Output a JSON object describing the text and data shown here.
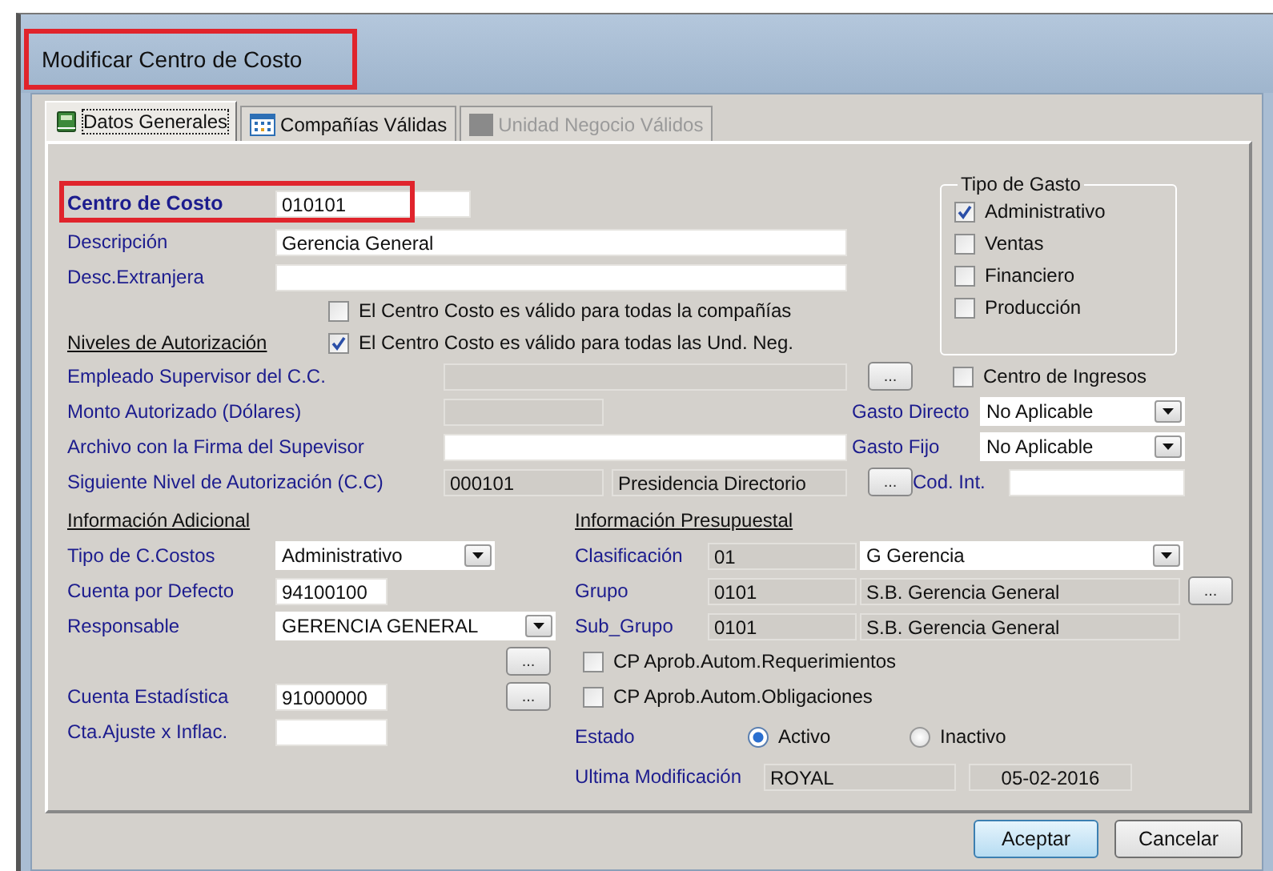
{
  "window": {
    "title": "Modificar Centro de Costo"
  },
  "tabs": [
    {
      "label": "Datos Generales",
      "selected": true,
      "disabled": false,
      "kind": "book"
    },
    {
      "label": "Compañías Válidas",
      "selected": false,
      "disabled": false,
      "kind": "grid"
    },
    {
      "label": "Unidad Negocio Válidos",
      "selected": false,
      "disabled": true,
      "kind": "blank"
    }
  ],
  "cost_center": {
    "label": "Centro de Costo",
    "value": "010101"
  },
  "description": {
    "label": "Descripción",
    "value": "Gerencia General"
  },
  "foreign_description": {
    "label": "Desc.Extranjera"
  },
  "validity": [
    {
      "label": "El Centro Costo es válido para todas la compañías",
      "checked": false
    },
    {
      "label": "El Centro Costo es válido para todas las Und. Neg.",
      "checked": true
    }
  ],
  "authorization": {
    "heading": "Niveles de Autorización",
    "rows": [
      {
        "label": "Empleado Supervisor del C.C.",
        "fields": [
          {
            "disabled": true
          }
        ],
        "lookup": "..."
      },
      {
        "label": "Monto Autorizado (Dólares)",
        "fields": [
          {
            "disabled": true
          }
        ]
      },
      {
        "label": "Archivo con la Firma del Supevisor",
        "fields": [
          {
            "disabled": false
          }
        ]
      },
      {
        "label": "Siguiente Nivel de Autorización (C.C)",
        "fields": [
          {
            "value": "000101",
            "disabled": true
          },
          {
            "value": "Presidencia Directorio",
            "disabled": true
          }
        ],
        "lookup": "..."
      }
    ]
  },
  "expense_type": {
    "title": "Tipo de Gasto",
    "options": [
      {
        "label": "Administrativo",
        "checked": true
      },
      {
        "label": "Ventas",
        "checked": false
      },
      {
        "label": "Financiero",
        "checked": false
      },
      {
        "label": "Producción",
        "checked": false
      }
    ]
  },
  "income_center": {
    "label": "Centro de Ingresos",
    "checked": false
  },
  "direct_expense": {
    "label": "Gasto Directo",
    "value": "No Aplicable"
  },
  "fixed_expense": {
    "label": "Gasto Fijo",
    "value": "No Aplicable"
  },
  "internal_code": {
    "label": "Cod. Int."
  },
  "additional": {
    "heading": "Información Adicional",
    "rows": [
      {
        "kind": "dropdown",
        "label": "Tipo de C.Costos",
        "value": "Administrativo"
      },
      {
        "kind": "text",
        "label": "Cuenta por Defecto",
        "value": "94100100"
      },
      {
        "kind": "dropdown",
        "label": "Responsable",
        "value": "GERENCIA GENERAL"
      },
      {
        "kind": "button",
        "lookup": "..."
      },
      {
        "kind": "text",
        "label": "Cuenta Estadística",
        "value": "91000000",
        "lookup": "..."
      },
      {
        "kind": "text",
        "label": "Cta.Ajuste x Inflac."
      }
    ]
  },
  "budget": {
    "heading": "Información Presupuestal",
    "rows": [
      {
        "kind": "dropdown",
        "label": "Clasificación",
        "code": "01",
        "name": "G Gerencia"
      },
      {
        "kind": "text",
        "label": "Grupo",
        "code": "0101",
        "name": "S.B. Gerencia General",
        "lookup": "..."
      },
      {
        "kind": "text",
        "label": "Sub_Grupo",
        "code": "0101",
        "name": "S.B. Gerencia General"
      }
    ],
    "approvals": [
      {
        "label": "CP Aprob.Autom.Requerimientos",
        "checked": false
      },
      {
        "label": "CP Aprob.Autom.Obligaciones",
        "checked": false
      }
    ]
  },
  "status": {
    "label": "Estado",
    "options": [
      {
        "label": "Activo",
        "selected": true
      },
      {
        "label": "Inactivo",
        "selected": false
      }
    ]
  },
  "last_modified": {
    "label": "Ultima Modificación",
    "user": "ROYAL",
    "date": "05-02-2016"
  },
  "buttons": [
    {
      "label": "Aceptar",
      "default": true
    },
    {
      "label": "Cancelar",
      "default": false
    }
  ]
}
